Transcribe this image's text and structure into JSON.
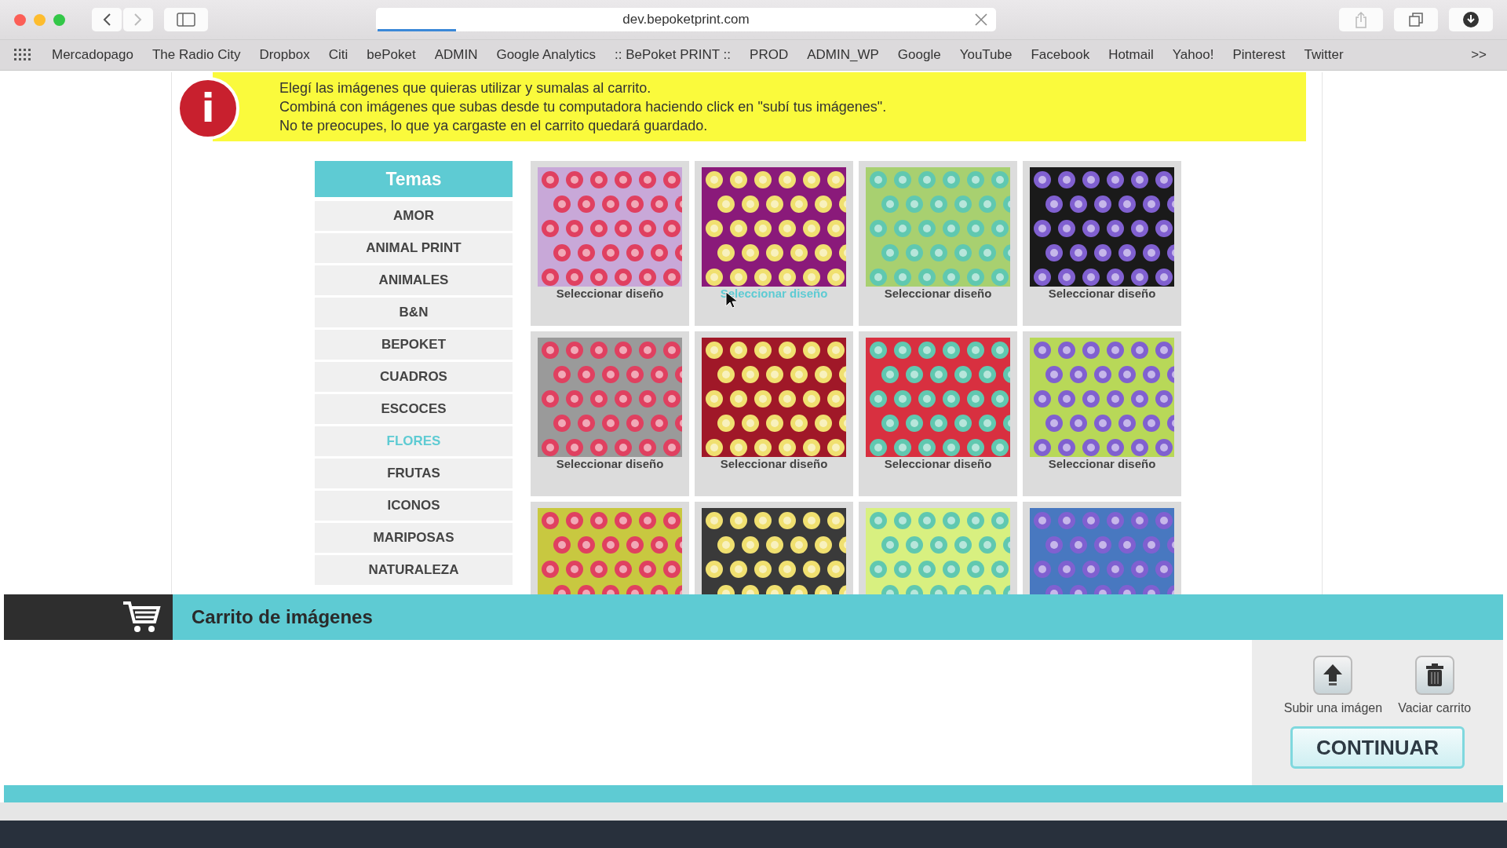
{
  "browser": {
    "url": "dev.bepoketprint.com",
    "bookmarks": [
      "Mercadopago",
      "The Radio City",
      "Dropbox",
      "Citi",
      "bePoket",
      "ADMIN",
      "Google Analytics",
      ":: BePoket PRINT ::",
      "PROD",
      "ADMIN_WP",
      "Google",
      "YouTube",
      "Facebook",
      "Hotmail",
      "Yahoo!",
      "Pinterest",
      "Twitter"
    ],
    "overflow": ">>"
  },
  "info_banner": {
    "icon": "i",
    "lines": [
      "Elegí las imágenes que quieras utilizar y sumalas al carrito.",
      "Combiná con imágenes que subas desde tu computadora haciendo click en \"subí tus imágenes\".",
      "No te preocupes, lo que ya cargaste en el carrito quedará guardado."
    ]
  },
  "themes": {
    "title": "Temas",
    "items": [
      {
        "label": "AMOR",
        "selected": false
      },
      {
        "label": "ANIMAL PRINT",
        "selected": false
      },
      {
        "label": "ANIMALES",
        "selected": false
      },
      {
        "label": "B&N",
        "selected": false
      },
      {
        "label": "BEPOKET",
        "selected": false
      },
      {
        "label": "CUADROS",
        "selected": false
      },
      {
        "label": "ESCOCES",
        "selected": false
      },
      {
        "label": "FLORES",
        "selected": true
      },
      {
        "label": "FRUTAS",
        "selected": false
      },
      {
        "label": "ICONOS",
        "selected": false
      },
      {
        "label": "MARIPOSAS",
        "selected": false
      },
      {
        "label": "NATURALEZA",
        "selected": false
      }
    ]
  },
  "designs": [
    {
      "color": "#c8a8d8",
      "caption": "Seleccionar diseño",
      "hovered": false
    },
    {
      "color": "#8a1a7a",
      "caption": "Seleccionar diseño",
      "hovered": true
    },
    {
      "color": "#a8d070",
      "caption": "Seleccionar diseño",
      "hovered": false
    },
    {
      "color": "#1a1a1a",
      "caption": "Seleccionar diseño",
      "hovered": false
    },
    {
      "color": "#9a9a9a",
      "caption": "Seleccionar diseño",
      "hovered": false
    },
    {
      "color": "#a01828",
      "caption": "Seleccionar diseño",
      "hovered": false
    },
    {
      "color": "#d83040",
      "caption": "Seleccionar diseño",
      "hovered": false
    },
    {
      "color": "#b8d858",
      "caption": "Seleccionar diseño",
      "hovered": false
    },
    {
      "color": "#c8c840"
    },
    {
      "color": "#3a3a3a"
    },
    {
      "color": "#d8f080"
    },
    {
      "color": "#4878c0"
    }
  ],
  "cart": {
    "title": "Carrito de imágenes",
    "actions": [
      {
        "kind": "upload",
        "label": "Subir una imágen"
      },
      {
        "kind": "trash",
        "label": "Vaciar carrito"
      }
    ],
    "continue": "CONTINUAR"
  }
}
